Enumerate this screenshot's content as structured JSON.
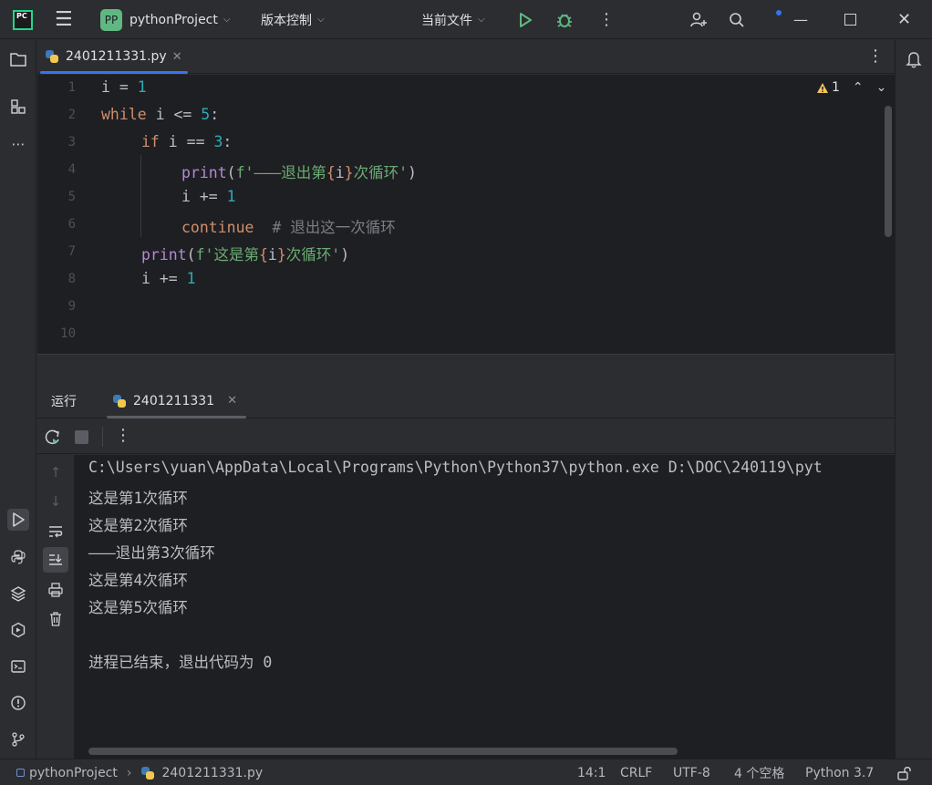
{
  "titlebar": {
    "logo_text": "PC",
    "project_badge": "PP",
    "project_name": "pythonProject",
    "vcs_label": "版本控制",
    "run_config": "当前文件"
  },
  "editor": {
    "tab": {
      "filename": "2401211331.py"
    },
    "warnings_count": "1",
    "line_numbers": [
      "1",
      "2",
      "3",
      "4",
      "5",
      "6",
      "7",
      "8",
      "9",
      "10"
    ],
    "code": {
      "l1_var": "i",
      "l1_op": " = ",
      "l1_num": "1",
      "l2_kw": "while",
      "l2_mid": " i <= ",
      "l2_num": "5",
      "l2_end": ":",
      "l3_kw": "if",
      "l3_mid": " i == ",
      "l3_num": "3",
      "l3_end": ":",
      "l4_fn": "print",
      "l4_p1": "(",
      "l4_s1": "f'———退出第",
      "l4_b1": "{",
      "l4_v": "i",
      "l4_b2": "}",
      "l4_s2": "次循环'",
      "l4_p2": ")",
      "l5_mid": "i += ",
      "l5_num": "1",
      "l6_kw": "continue",
      "l6_cmt": "  # 退出这一次循环",
      "l7_fn": "print",
      "l7_p1": "(",
      "l7_s1": "f'这是第",
      "l7_b1": "{",
      "l7_v": "i",
      "l7_b2": "}",
      "l7_s2": "次循环'",
      "l7_p2": ")",
      "l8_mid": "i += ",
      "l8_num": "1"
    }
  },
  "run_panel": {
    "title": "运行",
    "tab_label": "2401211331",
    "output": [
      "C:\\Users\\yuan\\AppData\\Local\\Programs\\Python\\Python37\\python.exe D:\\DOC\\240119\\pyt",
      "这是第1次循环",
      "这是第2次循环",
      "———退出第3次循环",
      "这是第4次循环",
      "这是第5次循环",
      "",
      "进程已结束，退出代码为 0"
    ]
  },
  "statusbar": {
    "project": "pythonProject",
    "file": "2401211331.py",
    "position": "14:1",
    "line_sep": "CRLF",
    "encoding": "UTF-8",
    "indent": "4 个空格",
    "interpreter": "Python 3.7"
  },
  "colors": {
    "accent": "#3574f0",
    "run_green": "#5fb882",
    "keyword": "#cf8e6d",
    "number": "#2aacb8",
    "string": "#6aab73",
    "function": "#b589d6",
    "comment": "#7a7e85"
  }
}
